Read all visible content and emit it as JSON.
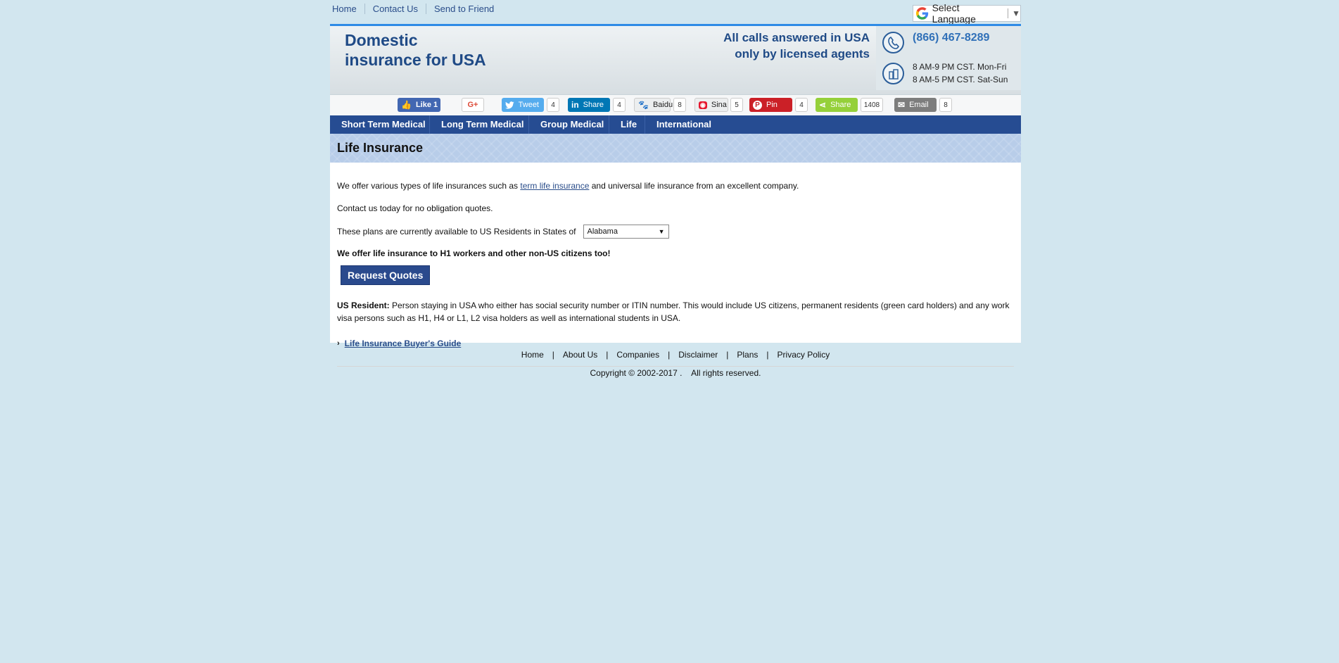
{
  "top_links": [
    "Home",
    "Contact Us",
    "Send to Friend"
  ],
  "language": {
    "label": "Select Language",
    "arrow": "▼"
  },
  "header": {
    "brand_line1": "Domestic",
    "brand_line2": "insurance for USA",
    "calls_line1": "All calls answered in USA",
    "calls_line2": "only by licensed agents",
    "phone": "(866) 467-8289",
    "hours1": "8 AM-9 PM CST. Mon-Fri",
    "hours2": "8 AM-5 PM CST. Sat-Sun"
  },
  "social": {
    "like": "Like 1",
    "gplus": "G+",
    "tweet": "Tweet",
    "tweet_count": "4",
    "linkedin": "Share",
    "linkedin_count": "4",
    "baidu": "Baidu",
    "baidu_count": "8",
    "sina": "Sina",
    "sina_count": "5",
    "pin": "Pin",
    "pin_count": "4",
    "share": "Share",
    "share_count": "1408",
    "email": "Email",
    "email_count": "8"
  },
  "nav": [
    "Short Term Medical",
    "Long Term Medical",
    "Group Medical",
    "Life",
    "International"
  ],
  "page_title": "Life Insurance",
  "content": {
    "p1_before": "We offer various types of life insurances such as ",
    "p1_link": "term life insurance",
    "p1_after": " and universal life insurance from an excellent company.",
    "p2": "Contact us today for no obligation quotes.",
    "states_label": "These plans are currently available to US Residents in States of",
    "state_selected": "Alabama",
    "bold_line": "We offer life insurance to H1 workers and other non-US citizens too!",
    "quote_button": "Request Quotes",
    "resident_label": "US Resident:",
    "resident_text": " Person staying in USA who either has social security number or ITIN number. This would include US citizens, permanent residents (green card holders) and any work visa persons such as H1, H4 or L1, L2 visa holders as well as international students in USA.",
    "guide_link": "Life Insurance Buyer's Guide"
  },
  "footer": {
    "links": [
      "Home",
      "About Us",
      "Companies",
      "Disclaimer",
      "Plans",
      "Privacy Policy"
    ],
    "separator": "|",
    "copyright": "Copyright © 2002-2017 .    All rights reserved."
  },
  "colors": {
    "background": "#d2e6ef",
    "brand": "#1f4a86",
    "nav": "#264c92",
    "facebook": "#4267b2",
    "twitter": "#55acee",
    "linkedin": "#0077b5",
    "pinterest": "#cb2027",
    "share": "#95d03a",
    "email": "#7d7d7d"
  }
}
